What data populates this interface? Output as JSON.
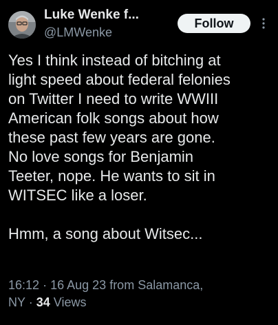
{
  "author": {
    "display_name": "Luke Wenke f...",
    "handle": "@LMWenke",
    "avatar_icon": "profile-photo"
  },
  "follow_button": {
    "label": "Follow"
  },
  "more_menu": {
    "icon": "vertical-dots-icon"
  },
  "tweet": {
    "lines": [
      "Yes I think instead of bitching at",
      "light speed about federal felonies",
      "on Twitter I need to write WWIII",
      "American folk songs about how",
      "these past few years are gone.",
      "No love songs for Benjamin",
      "Teeter, nope.  He wants to sit in",
      "WITSEC like a loser.",
      "",
      "Hmm, a song about Witsec..."
    ]
  },
  "meta": {
    "time": "16:12",
    "separator": "·",
    "date": "16 Aug 23",
    "source_prefix": "from Salamanca,",
    "source_suffix": "NY",
    "views_count": "34",
    "views_label": "Views"
  },
  "colors": {
    "background": "#000000",
    "primary_text": "#e7e9ea",
    "secondary_text": "#8b98a5",
    "follow_bg": "#eff3f4",
    "follow_text": "#0f1419"
  }
}
